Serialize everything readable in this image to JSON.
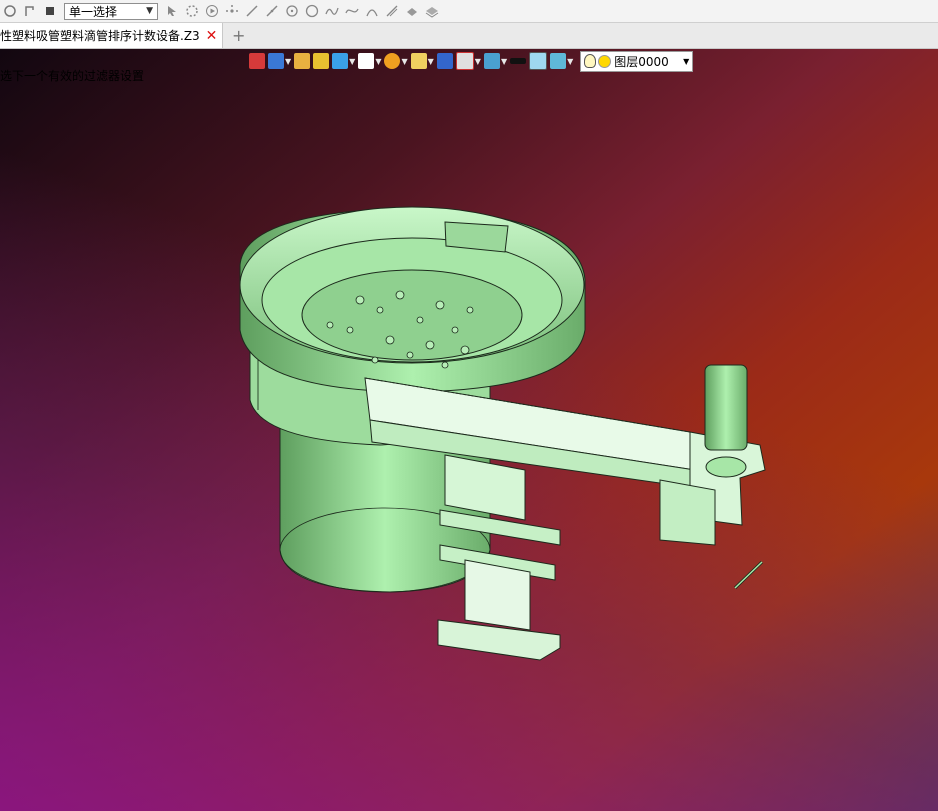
{
  "toolbar": {
    "select_mode": "单一选择",
    "icons": [
      "rotate-icon",
      "step-icon",
      "stop-icon",
      "cursor-icon",
      "filter-select-icon",
      "play-icon",
      "point-icon",
      "line-icon",
      "line2-icon",
      "circle-center-icon",
      "circle-icon",
      "spline-icon",
      "curve-icon",
      "arc-icon",
      "curve2-icon",
      "pattern-icon",
      "surface-icon"
    ]
  },
  "tabs": [
    {
      "title": "性塑料吸管塑料滴管排序计数设备.Z3",
      "active": true
    }
  ],
  "tab_add": "+",
  "status_hint": "选下一个有效的过滤器设置",
  "cad_toolbar": {
    "layer_name": "图层0000",
    "colors": {
      "accent": "#9be39b"
    }
  }
}
